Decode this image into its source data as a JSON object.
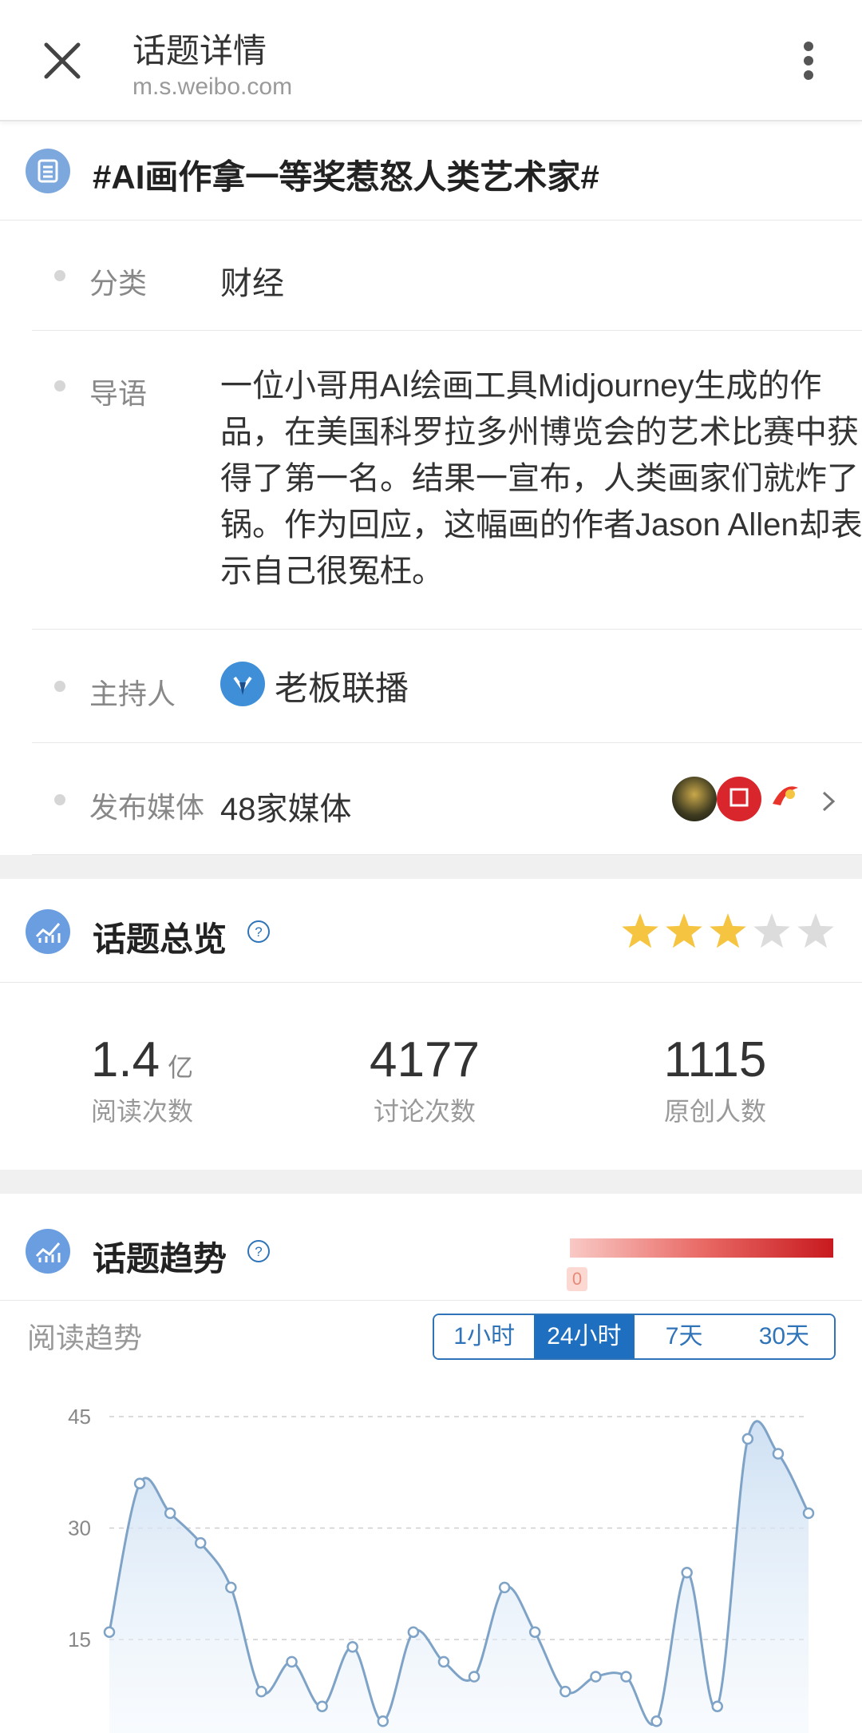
{
  "header": {
    "title": "话题详情",
    "url": "m.s.weibo.com"
  },
  "topic": {
    "title": "#AI画作拿一等奖惹怒人类艺术家#"
  },
  "info": {
    "category": {
      "label": "分类",
      "value": "财经"
    },
    "intro": {
      "label": "导语",
      "value": "一位小哥用AI绘画工具Midjourney生成的作品，在美国科罗拉多州博览会的艺术比赛中获得了第一名。结果一宣布，人类画家们就炸了锅。作为回应，这幅画的作者Jason Allen却表示自己很冤枉。"
    },
    "host": {
      "label": "主持人",
      "value": "老板联播"
    },
    "media": {
      "label": "发布媒体",
      "value": "48家媒体"
    }
  },
  "overview": {
    "title": "话题总览",
    "rating": 3,
    "rating_max": 5,
    "stats": [
      {
        "value": "1.4",
        "unit": "亿",
        "label": "阅读次数"
      },
      {
        "value": "4177",
        "unit": "",
        "label": "讨论次数"
      },
      {
        "value": "1115",
        "unit": "",
        "label": "原创人数"
      }
    ]
  },
  "trend": {
    "title": "话题趋势",
    "heat_scale_start": "0",
    "subtitle": "阅读趋势",
    "tabs": [
      "1小时",
      "24小时",
      "7天",
      "30天"
    ],
    "active_tab": "24小时"
  },
  "colors": {
    "accent": "#1f6fc0",
    "star": "#f5c542",
    "star_empty": "#dcdcdc",
    "line": "#7ea3c7"
  },
  "chart_data": {
    "type": "area",
    "y_ticks": [
      "45",
      "30",
      "15"
    ],
    "ylim": [
      0,
      48
    ],
    "grid": true,
    "values": [
      16,
      36,
      32,
      28,
      22,
      8,
      12,
      6,
      14,
      4,
      16,
      12,
      10,
      22,
      16,
      8,
      10,
      10,
      4,
      24,
      6,
      42,
      40,
      32
    ]
  }
}
